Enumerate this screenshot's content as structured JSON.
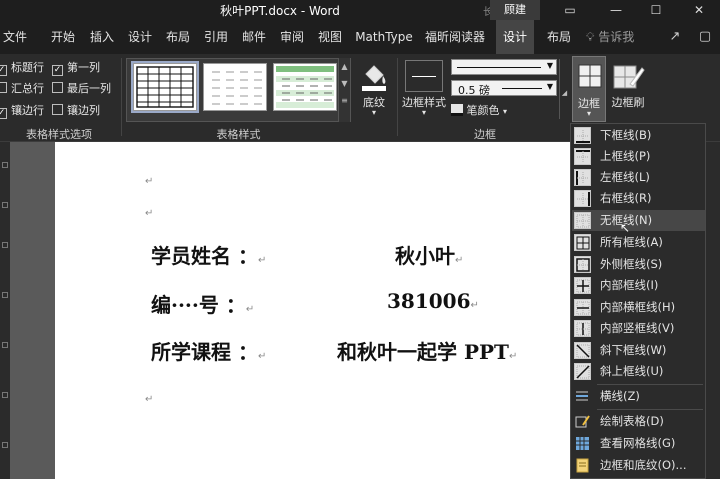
{
  "window": {
    "title": "秋叶PPT.docx  -  Word",
    "ext_fragment": "长.",
    "user": "顾建"
  },
  "tabs": {
    "items": [
      {
        "label": "文件"
      },
      {
        "label": "开始"
      },
      {
        "label": "插入"
      },
      {
        "label": "设计"
      },
      {
        "label": "布局"
      },
      {
        "label": "引用"
      },
      {
        "label": "邮件"
      },
      {
        "label": "审阅"
      },
      {
        "label": "视图"
      },
      {
        "label": "MathType"
      },
      {
        "label": "福昕阅读器"
      },
      {
        "label": "设计"
      },
      {
        "label": "布局"
      }
    ],
    "tell_me": "告诉我"
  },
  "ribbon": {
    "options": {
      "header_row": "标题行",
      "first_column": "第一列",
      "total_row": "汇总行",
      "last_column": "最后一列",
      "banded_rows": "镶边行",
      "banded_columns": "镶边列",
      "group_label": "表格样式选项"
    },
    "styles": {
      "group_label": "表格样式",
      "shading_label": "底纹"
    },
    "borders": {
      "border_styles_label": "边框样式",
      "weight_value": "0.5 磅",
      "pen_color_label": "笔颜色",
      "borders_label": "边框",
      "painter_label": "边框刷",
      "group_label": "边框"
    }
  },
  "document": {
    "rows": [
      {
        "label": "学员姓名 ：",
        "value": "秋小叶"
      },
      {
        "label": "编····号 ：",
        "value": "381006"
      },
      {
        "label": "所学课程 ：",
        "value": "和秋叶一起学 PPT"
      }
    ],
    "para_mark": "↵"
  },
  "border_menu": {
    "items": [
      {
        "label": "下框线(B)"
      },
      {
        "label": "上框线(P)"
      },
      {
        "label": "左框线(L)"
      },
      {
        "label": "右框线(R)"
      },
      {
        "label": "无框线(N)"
      },
      {
        "label": "所有框线(A)"
      },
      {
        "label": "外侧框线(S)"
      },
      {
        "label": "内部框线(I)"
      },
      {
        "label": "内部横框线(H)"
      },
      {
        "label": "内部竖框线(V)"
      },
      {
        "label": "斜下框线(W)"
      },
      {
        "label": "斜上框线(U)"
      },
      {
        "label": "横线(Z)"
      },
      {
        "label": "绘制表格(D)"
      },
      {
        "label": "查看网格线(G)"
      },
      {
        "label": "边框和底纹(O)..."
      }
    ]
  },
  "colors": {
    "accent_tab": "#454545",
    "style_green": "#9ccf9c"
  }
}
